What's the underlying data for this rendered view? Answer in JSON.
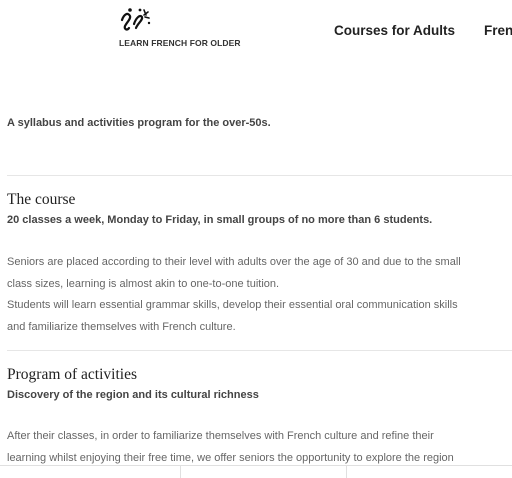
{
  "header": {
    "logo_text": "LEARN FRENCH FOR OLDER",
    "logo_icon": "logo-mark-icon",
    "nav": [
      {
        "label": "Courses for Adults"
      },
      {
        "label": "French"
      }
    ]
  },
  "intro": "A syllabus and activities program for the over-50s.",
  "course": {
    "title": "The course",
    "subtitle": "20 classes a week, Monday to Friday, in small groups of no more than 6 students.",
    "lines": [
      "Seniors are placed according to their level with adults over the age of 30 and due to the small",
      "class sizes, learning is almost akin to one-to-one tuition.",
      "Students will learn essential grammar skills, develop their essential oral communication skills",
      "and familiarize themselves with French culture."
    ]
  },
  "activities": {
    "title": "Program of activities",
    "subtitle": "Discovery of the region and its cultural richness",
    "lines": [
      "After their classes, in order to familiarize themselves with French culture and refine their",
      "learning whilst enjoying their free time, we offer seniors the opportunity to explore the region"
    ]
  },
  "colors": {
    "text_heading": "#222222",
    "text_body": "#666666",
    "text_bold": "#444444",
    "divider": "#e6e6e6",
    "background": "#ffffff"
  }
}
